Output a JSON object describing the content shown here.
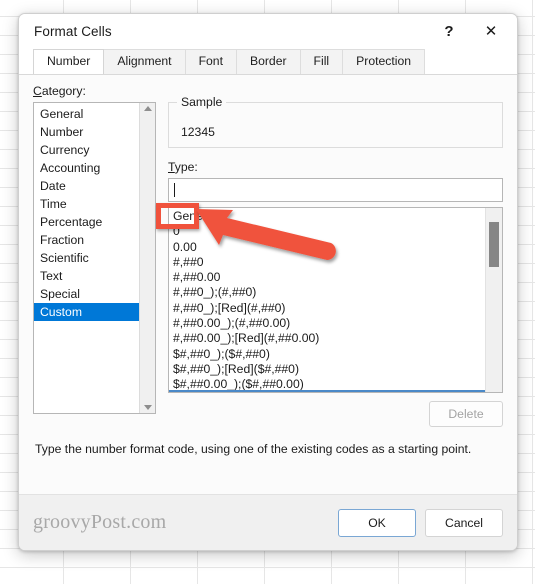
{
  "window": {
    "title": "Format Cells",
    "help_label": "?",
    "close_label": "✕"
  },
  "tabs": [
    {
      "label": "Number",
      "active": true
    },
    {
      "label": "Alignment",
      "active": false
    },
    {
      "label": "Font",
      "active": false
    },
    {
      "label": "Border",
      "active": false
    },
    {
      "label": "Fill",
      "active": false
    },
    {
      "label": "Protection",
      "active": false
    }
  ],
  "category": {
    "label": "Category:",
    "label_accel": "C",
    "items": [
      "General",
      "Number",
      "Currency",
      "Accounting",
      "Date",
      "Time",
      "Percentage",
      "Fraction",
      "Scientific",
      "Text",
      "Special",
      "Custom"
    ],
    "selected": "Custom"
  },
  "sample": {
    "title": "Sample",
    "value": "12345"
  },
  "type": {
    "label": "Type:",
    "label_accel": "T",
    "input_value": "",
    "items": [
      "General",
      "0",
      "0.00",
      "#,##0",
      "#,##0.00",
      "#,##0_);(#,##0)",
      "#,##0_);[Red](#,##0)",
      "#,##0.00_);(#,##0.00)",
      "#,##0.00_);[Red](#,##0.00)",
      "$#,##0_);($#,##0)",
      "$#,##0_);[Red]($#,##0)",
      "$#,##0.00_);($#,##0.00)"
    ],
    "highlighted_item": "0"
  },
  "buttons": {
    "delete": "Delete",
    "ok": "OK",
    "cancel": "Cancel"
  },
  "hint": "Type the number format code, using one of the existing codes as a starting point.",
  "watermark": "groovyPost.com",
  "colors": {
    "selection_blue": "#0078d7",
    "annotation_red": "#f0523c",
    "focus_border": "#7aa7d4",
    "scrollbar_thumb": "#868686"
  }
}
